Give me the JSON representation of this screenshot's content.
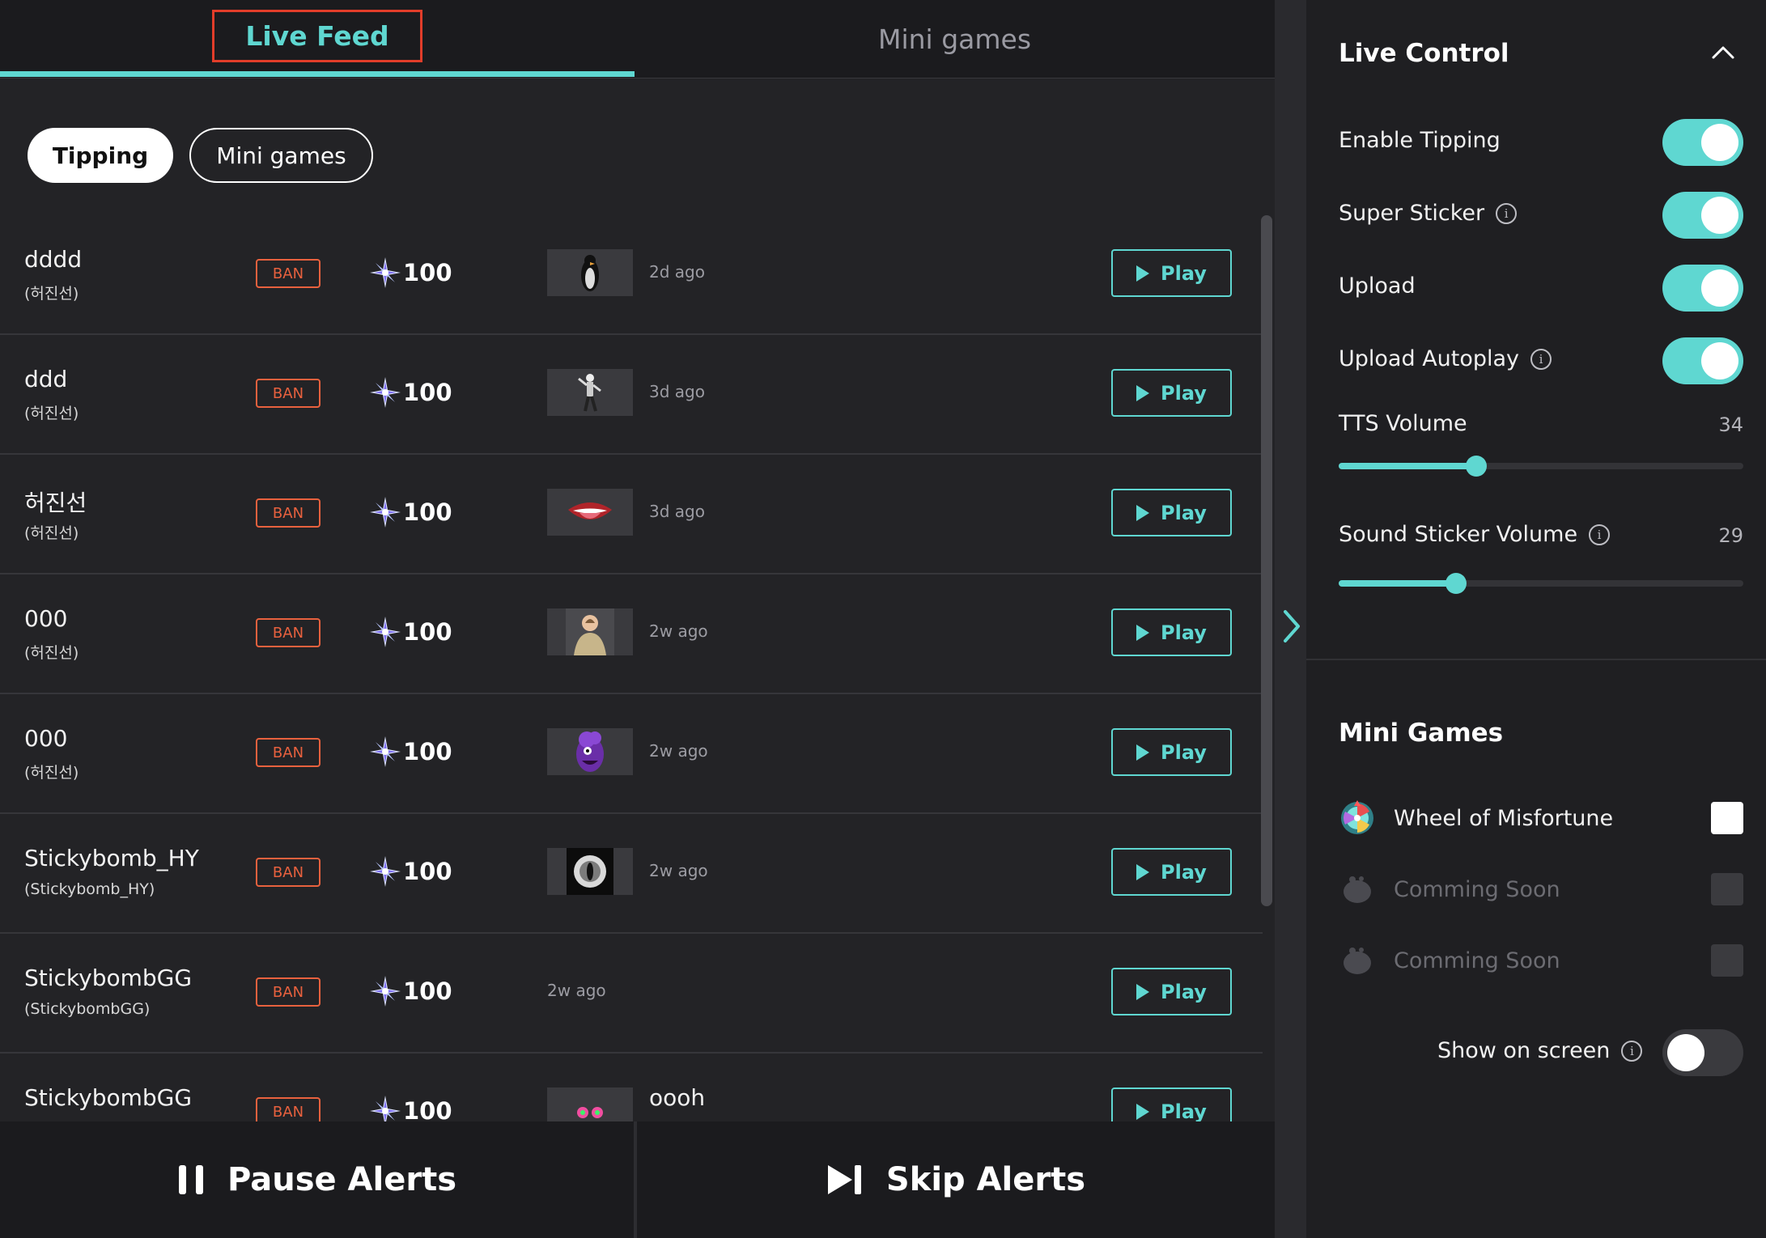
{
  "tabs": [
    {
      "label": "Live Feed",
      "active": true
    },
    {
      "label": "Mini games",
      "active": false
    }
  ],
  "filters": [
    {
      "label": "Tipping",
      "active": true
    },
    {
      "label": "Mini games",
      "active": false
    }
  ],
  "feed": {
    "ban_label": "BAN",
    "play_label": "Play",
    "rows": [
      {
        "name": "dddd",
        "handle": "(허진선)",
        "amount": "100",
        "has_thumb": true,
        "thumb_icon": "penguin-thumbnail",
        "time": "2d ago"
      },
      {
        "name": "ddd",
        "handle": "(허진선)",
        "amount": "100",
        "has_thumb": true,
        "thumb_icon": "dancer-thumbnail",
        "time": "3d ago"
      },
      {
        "name": "허진선",
        "handle": "(허진선)",
        "amount": "100",
        "has_thumb": true,
        "thumb_icon": "lips-thumbnail",
        "time": "3d ago"
      },
      {
        "name": "000",
        "handle": "(허진선)",
        "amount": "100",
        "has_thumb": true,
        "thumb_icon": "person-thumbnail",
        "time": "2w ago"
      },
      {
        "name": "000",
        "handle": "(허진선)",
        "amount": "100",
        "has_thumb": true,
        "thumb_icon": "purple-minion-thumbnail",
        "time": "2w ago"
      },
      {
        "name": "Stickybomb_HY",
        "handle": "(Stickybomb_HY)",
        "amount": "100",
        "has_thumb": true,
        "thumb_icon": "cat-eye-thumbnail",
        "time": "2w ago"
      },
      {
        "name": "StickybombGG",
        "handle": "(StickybombGG)",
        "amount": "100",
        "has_thumb": false,
        "thumb_icon": "",
        "time": "2w ago"
      },
      {
        "name": "StickybombGG",
        "handle": "",
        "amount": "100",
        "has_thumb": true,
        "thumb_icon": "eyes-thumbnail",
        "time": "oooh"
      }
    ]
  },
  "bottom": {
    "pause_label": "Pause Alerts",
    "skip_label": "Skip Alerts"
  },
  "live_control": {
    "title": "Live Control",
    "toggles": [
      {
        "label": "Enable Tipping",
        "info": false,
        "on": true
      },
      {
        "label": "Super Sticker",
        "info": true,
        "on": true
      },
      {
        "label": "Upload",
        "info": false,
        "on": true
      },
      {
        "label": "Upload Autoplay",
        "info": true,
        "on": true
      }
    ],
    "tts_volume": {
      "label": "TTS Volume",
      "value": "34",
      "level": 34
    },
    "sound_volume": {
      "label": "Sound Sticker Volume",
      "value": "29",
      "level": 29
    }
  },
  "mini_games": {
    "title": "Mini Games",
    "games": [
      {
        "name": "Wheel of Misfortune",
        "enabled": true,
        "icon": "wheel-icon"
      },
      {
        "name": "Comming Soon",
        "enabled": false,
        "icon": "blob-icon"
      },
      {
        "name": "Comming Soon",
        "enabled": false,
        "icon": "blob-icon"
      }
    ],
    "show_on_screen": {
      "label": "Show on screen",
      "on": false
    }
  },
  "colors": {
    "accent": "#5fd7d1",
    "ban": "#e8613e",
    "highlight_box": "#e23d2a"
  }
}
